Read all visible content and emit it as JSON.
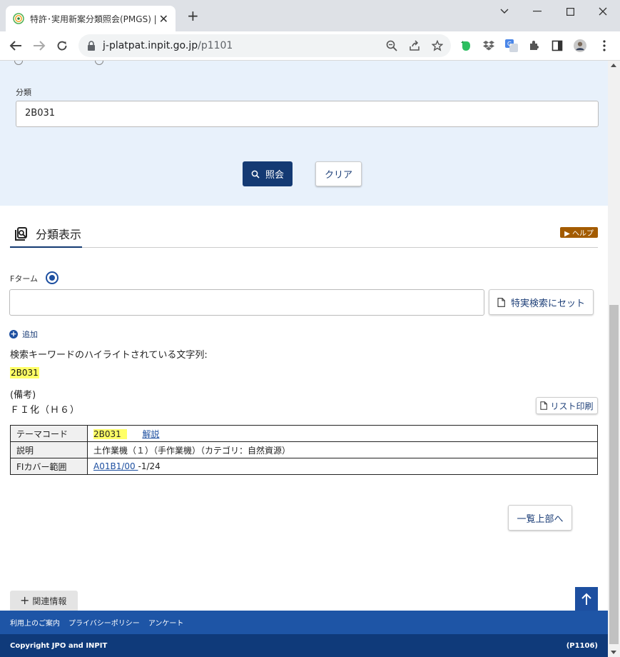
{
  "browser": {
    "tab_title": "特許･実用新案分類照会(PMGS) |",
    "tab_close": "✕",
    "new_tab": "+",
    "url_host": "j-platpat.inpit.go.jp",
    "url_path": "/p1101"
  },
  "search": {
    "classification_label": "分類",
    "classification_value": "2B031",
    "search_button": "照会",
    "clear_button": "クリア"
  },
  "display": {
    "section_title": "分類表示",
    "help_label": "▶ ヘルプ",
    "fterm_label": "Fターム",
    "fterm_input_value": "",
    "set_button": "特実検索にセット",
    "add_label": "追加",
    "highlight_caption": "検索キーワードのハイライトされている文字列:",
    "highlight_keyword": "2B031",
    "remarks_label": "(備考)",
    "remarks_text": "ＦＩ化（Ｈ６）",
    "print_button": "リスト印刷",
    "table": {
      "theme_code_label": "テーマコード",
      "theme_code_value": "2B031",
      "theme_code_link": "解説",
      "description_label": "説明",
      "description_value": "土作業機（１）（手作業機）（カテゴリ：自然資源）",
      "fi_cover_label": "FIカバー範囲",
      "fi_cover_link": "A01B1/00 ",
      "fi_cover_suffix": "-1/24"
    },
    "list_top_button": "一覧上部へ"
  },
  "related_info": "関連情報",
  "footer": {
    "links": [
      "利用上のご案内",
      "プライバシーポリシー",
      "アンケート"
    ],
    "copyright": "Copyright JPO and INPIT",
    "page_id": "(P1106)"
  },
  "colors": {
    "primary": "#143a73",
    "footer_top": "#1e55a6",
    "footer_bottom": "#0f3a7a",
    "highlight": "#ffff66",
    "help_badge": "#a35b00",
    "panel_bg": "#e8f1fb"
  }
}
